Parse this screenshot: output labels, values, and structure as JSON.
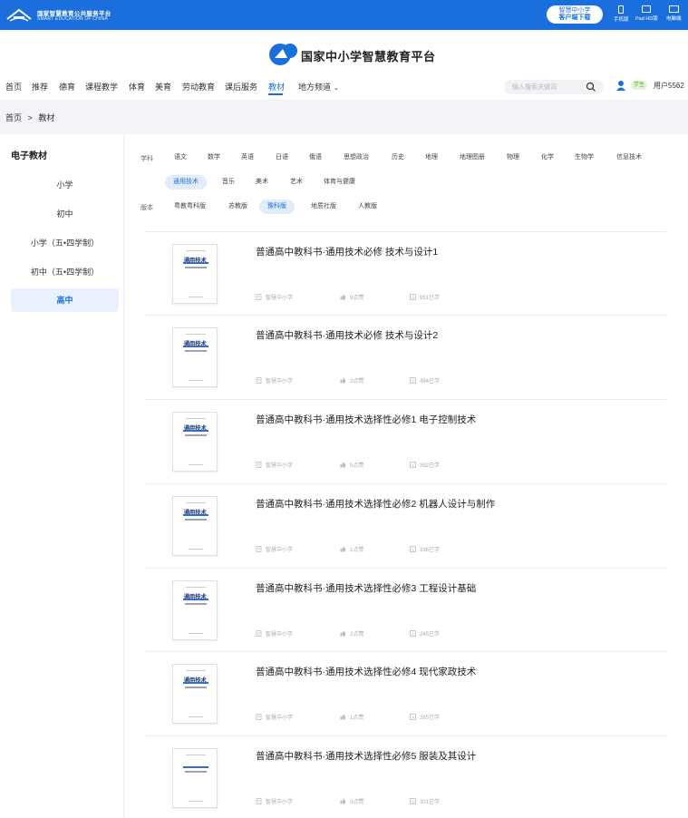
{
  "topbar": {
    "logo_title": "国家智慧教育公共服务平台",
    "logo_sub": "SMART EDUCATION OF CHINA",
    "client_btn_line1": "智慧中小学",
    "client_btn_line2": "客户端下载",
    "devices": [
      "手机版",
      "Pad HD版",
      "电脑端"
    ]
  },
  "brand": {
    "name": "国家中小学智慧教育平台"
  },
  "nav": {
    "items": [
      "首页",
      "推荐",
      "德育",
      "课程教学",
      "体育",
      "美育",
      "劳动教育",
      "课后服务",
      "教材",
      "地方频道"
    ],
    "active": "教材",
    "dropdown_icon": "chevron-down-icon"
  },
  "search": {
    "placeholder": "输入搜索关键词"
  },
  "user": {
    "role": "学生",
    "name": "用户5562"
  },
  "breadcrumb": {
    "home": "首页",
    "sep": ">",
    "current": "教材"
  },
  "sidebar": {
    "title": "电子教材",
    "items": [
      "小学",
      "初中",
      "小学（五•四学制）",
      "初中（五•四学制）",
      "高中"
    ],
    "active": "高中"
  },
  "filters": {
    "subject_label": "学科",
    "subjects_row1": [
      "语文",
      "数学",
      "英语",
      "日语",
      "俄语",
      "思想政治",
      "历史",
      "地理",
      "地理图册",
      "物理",
      "化学",
      "生物学",
      "信息技术"
    ],
    "subjects_row2": [
      "通用技术",
      "音乐",
      "美术",
      "艺术",
      "体育与健康"
    ],
    "active_subject": "通用技术",
    "version_label": "版本",
    "versions": [
      "粤教粤科版",
      "苏教版",
      "豫科版",
      "地质社版",
      "人教版"
    ],
    "active_version": "豫科版"
  },
  "books": [
    {
      "title": "普通高中教科书·通用技术必修 技术与设计1",
      "publisher": "智慧中小学",
      "likes": "9点赞",
      "learners": "951已学",
      "cover_title": "通用技术"
    },
    {
      "title": "普通高中教科书·通用技术必修 技术与设计2",
      "publisher": "智慧中小学",
      "likes": "2点赞",
      "learners": "494已学",
      "cover_title": "通用技术"
    },
    {
      "title": "普通高中教科书·通用技术选择性必修1 电子控制技术",
      "publisher": "智慧中小学",
      "likes": "5点赞",
      "learners": "392已学",
      "cover_title": "通用技术"
    },
    {
      "title": "普通高中教科书·通用技术选择性必修2 机器人设计与制作",
      "publisher": "智慧中小学",
      "likes": "1点赞",
      "learners": "336已学",
      "cover_title": "通用技术"
    },
    {
      "title": "普通高中教科书·通用技术选择性必修3 工程设计基础",
      "publisher": "智慧中小学",
      "likes": "2点赞",
      "learners": "245已学",
      "cover_title": "通用技术"
    },
    {
      "title": "普通高中教科书·通用技术选择性必修4 现代家政技术",
      "publisher": "智慧中小学",
      "likes": "1点赞",
      "learners": "265已学",
      "cover_title": "通用技术"
    },
    {
      "title": "普通高中教科书·通用技术选择性必修5 服装及其设计",
      "publisher": "智慧中小学",
      "likes": "3点赞",
      "learners": "301已学",
      "cover_title": ""
    }
  ],
  "colors": {
    "brand_blue": "#1a6fdc",
    "active_bg": "#e8f1fd",
    "badge_green": "#52b82a"
  }
}
